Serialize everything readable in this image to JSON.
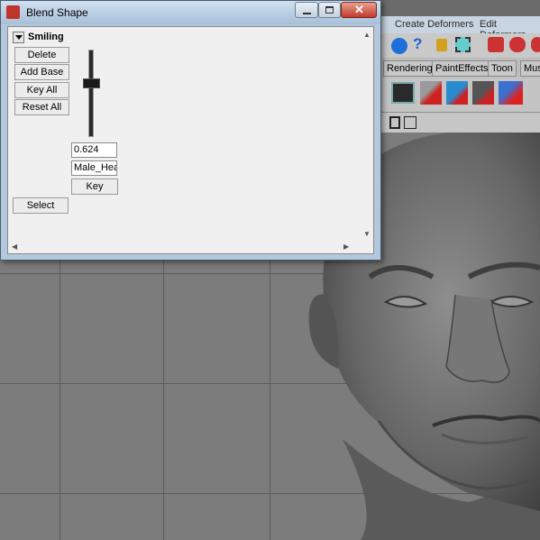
{
  "window": {
    "title": "Blend Shape",
    "target_name": "Smiling",
    "buttons": {
      "delete": "Delete",
      "add_base": "Add Base",
      "key_all": "Key All",
      "reset_all": "Reset All",
      "select": "Select",
      "key": "Key"
    },
    "weight_value": "0.624",
    "weight_slider_fraction": 0.624,
    "base_mesh_field": "Male_Head"
  },
  "app": {
    "menus": [
      "Create Deformers",
      "Edit Deformers"
    ],
    "shelf_tabs": [
      "Rendering",
      "PaintEffects",
      "Toon",
      "Mus"
    ],
    "colors": {
      "menubar": "#c8d4e2",
      "viewport": "#7c7c7c",
      "titlebar": "#b3c8dc",
      "close_button": "#c0392b"
    }
  }
}
